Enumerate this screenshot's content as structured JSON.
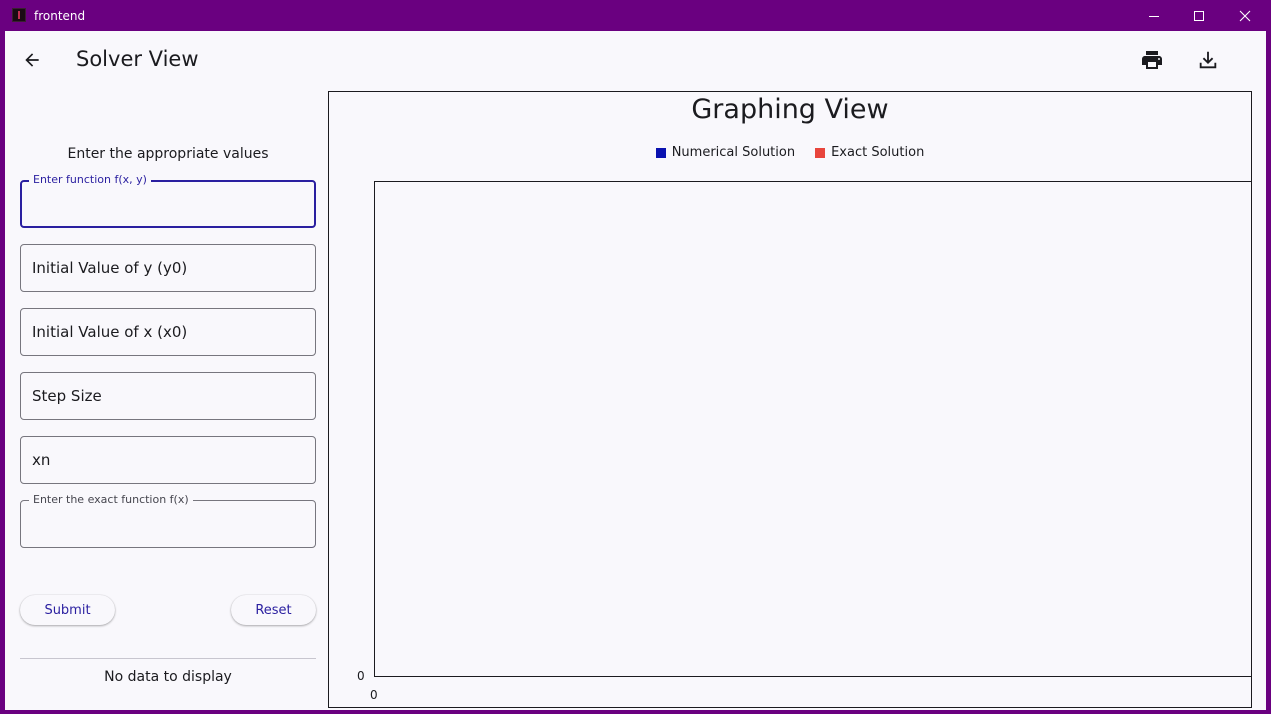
{
  "window": {
    "title": "frontend",
    "minimize_icon": "minimize-icon",
    "maximize_icon": "maximize-icon",
    "close_icon": "close-icon"
  },
  "appbar": {
    "title": "Solver View",
    "back_icon": "arrow-left-icon",
    "print_icon": "printer-icon",
    "download_icon": "download-icon"
  },
  "form": {
    "instructions": "Enter the appropriate values",
    "fields": [
      {
        "label": "Enter function f(x, y)",
        "placeholder": "",
        "value": ""
      },
      {
        "label": "",
        "placeholder": "Initial Value of y (y0)",
        "value": ""
      },
      {
        "label": "",
        "placeholder": "Initial Value of x (x0)",
        "value": ""
      },
      {
        "label": "",
        "placeholder": "Step Size",
        "value": ""
      },
      {
        "label": "",
        "placeholder": "xn",
        "value": ""
      },
      {
        "label": "Enter the exact function f(x)",
        "placeholder": "",
        "value": ""
      }
    ],
    "submit_label": "Submit",
    "reset_label": "Reset",
    "empty_message": "No data to display"
  },
  "colors": {
    "accent": "#2a1fa0",
    "titlebar": "#6a0080",
    "numerical": "#0a12b0",
    "exact": "#e8453c"
  },
  "chart_data": {
    "type": "line",
    "title": "Graphing View",
    "legend": "top-center",
    "series": [
      {
        "name": "Numerical Solution",
        "color": "#0a12b0",
        "x": [],
        "y": []
      },
      {
        "name": "Exact Solution",
        "color": "#e8453c",
        "x": [],
        "y": []
      }
    ],
    "x_ticks": [
      "0"
    ],
    "y_ticks": [
      "0"
    ]
  }
}
